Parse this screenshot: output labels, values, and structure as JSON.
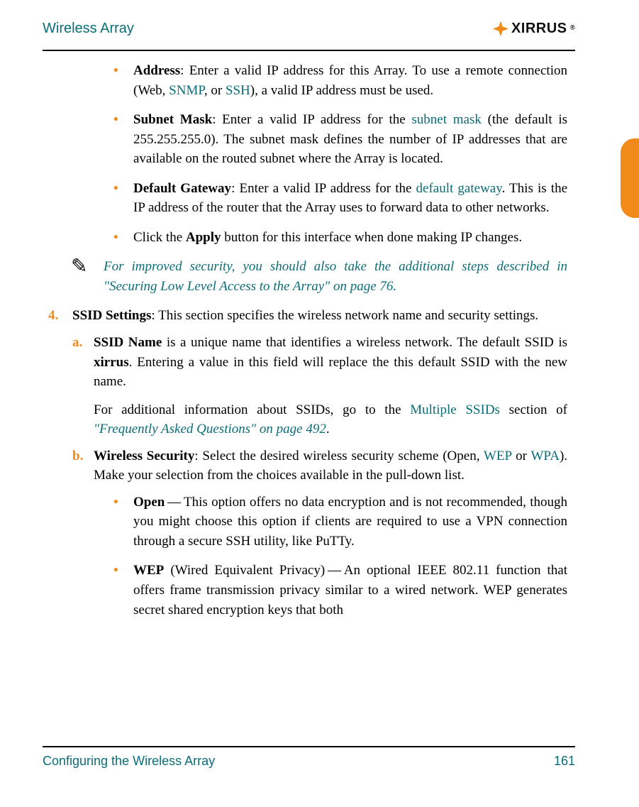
{
  "header": {
    "doc_title": "Wireless Array",
    "brand": "XIRRUS",
    "reg": "®"
  },
  "footer": {
    "section": "Configuring the Wireless Array",
    "page": "161"
  },
  "content": {
    "ip_items": {
      "address": {
        "label": "Address",
        "t1": ": Enter a valid IP address for this Array. To use a remote connection (Web, ",
        "snmp": "SNMP",
        "t2": ", or ",
        "ssh": "SSH",
        "t3": "), a valid IP address must be used."
      },
      "subnet": {
        "label": "Subnet Mask",
        "t1": ": Enter a valid IP address for the ",
        "link": "subnet mask",
        "t2": " (the default is 255.255.255.0). The subnet mask defines the number of IP addresses that are available on the routed subnet where the Array is located."
      },
      "gateway": {
        "label": "Default Gateway",
        "t1": ": Enter a valid IP address for the ",
        "link": "default gateway",
        "t2": ". This is the IP address of the router that the Array uses to forward data to other networks."
      },
      "apply": {
        "t1": "Click the ",
        "bold": "Apply",
        "t2": " button for this interface when done making IP changes."
      }
    },
    "note": {
      "icon": "✎",
      "text": "For improved security, you should also take the additional steps described in \"Securing Low Level Access to the Array\" on page 76."
    },
    "step4": {
      "num": "4.",
      "label": "SSID Settings",
      "t1": ": This section specifies the wireless network name and security settings."
    },
    "sub_a": {
      "let": "a.",
      "label": "SSID Name",
      "p1_t1": " is a unique name that identifies a wireless network. The default SSID is ",
      "p1_bold": "xirrus",
      "p1_t2": ". Entering a value in this field will replace the this default SSID with the new name.",
      "p2_t1": "For additional information about SSIDs, go to the ",
      "p2_link1": "Multiple SSIDs",
      "p2_t2": " section of ",
      "p2_link2": "\"Frequently Asked Questions\" on page 492",
      "p2_t3": "."
    },
    "sub_b": {
      "let": "b.",
      "label": "Wireless Security",
      "t1": ": Select the desired wireless security scheme (Open, ",
      "wep": "WEP",
      "t2": " or ",
      "wpa": "WPA",
      "t3": "). Make your selection from the choices available in the pull-down list."
    },
    "sec_items": {
      "open": {
        "label": "Open",
        "t1": " — This option offers no data encryption and is not recommended, though you might choose this option if clients are required to use a VPN connection through a secure SSH utility, like PuTTy."
      },
      "wep": {
        "label": "WEP",
        "t1": " (Wired Equivalent Privacy) — An optional IEEE 802.11 function that offers frame transmission privacy similar to a wired network. WEP generates secret shared encryption keys that both"
      }
    }
  }
}
